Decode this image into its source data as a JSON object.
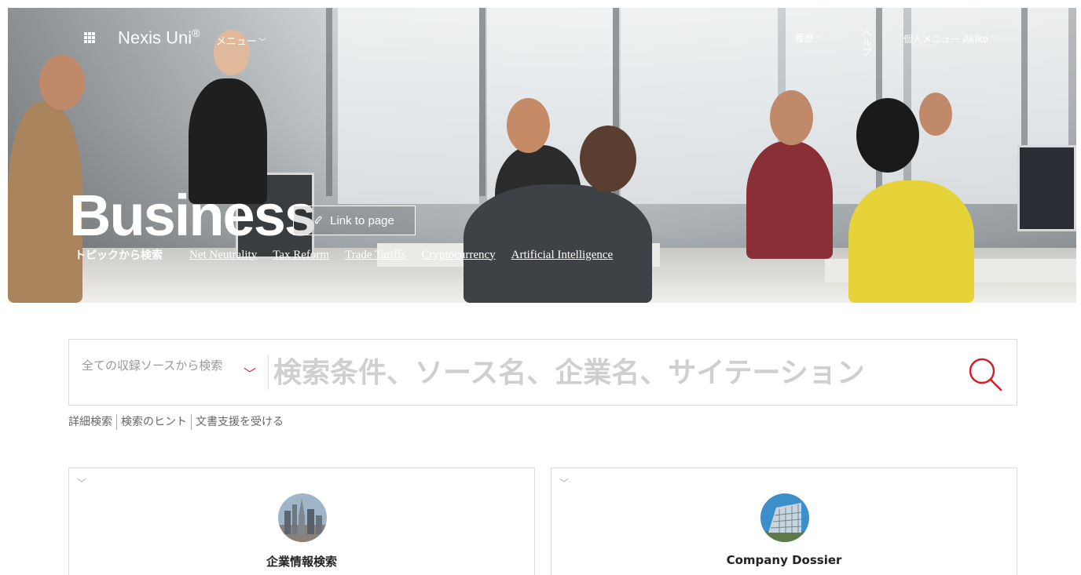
{
  "nav": {
    "brand": "Nexis Uni",
    "brand_mark": "®",
    "menu_label": "メニュー",
    "history_label": "履歴",
    "help_label": "ヘルプ",
    "user_menu_label": "個人メニュー Akiko",
    "grid_icon": "apps-grid-icon",
    "caret_icon": "chevron-down-icon"
  },
  "hero": {
    "title": "Business",
    "link_button": "Link to page",
    "link_icon": "paperclip-icon",
    "topics_label": "トピックから検索",
    "topics": [
      "Net Neutrality",
      "Tax Reform",
      "Trade Tariffs",
      "Cryptocurrency",
      "Artificial Intelligence"
    ]
  },
  "search": {
    "source_select": "全ての収録ソースから検索",
    "placeholder": "検索条件、ソース名、企業名、サイテーション",
    "search_icon": "search-icon",
    "accent_color": "#d21f2d",
    "links": [
      "詳細検索",
      "検索のヒント",
      "文書支援を受ける"
    ]
  },
  "cards": [
    {
      "title": "企業情報検索",
      "image": "city-skyline-image"
    },
    {
      "title": "Company Dossier",
      "image": "office-building-image"
    }
  ]
}
